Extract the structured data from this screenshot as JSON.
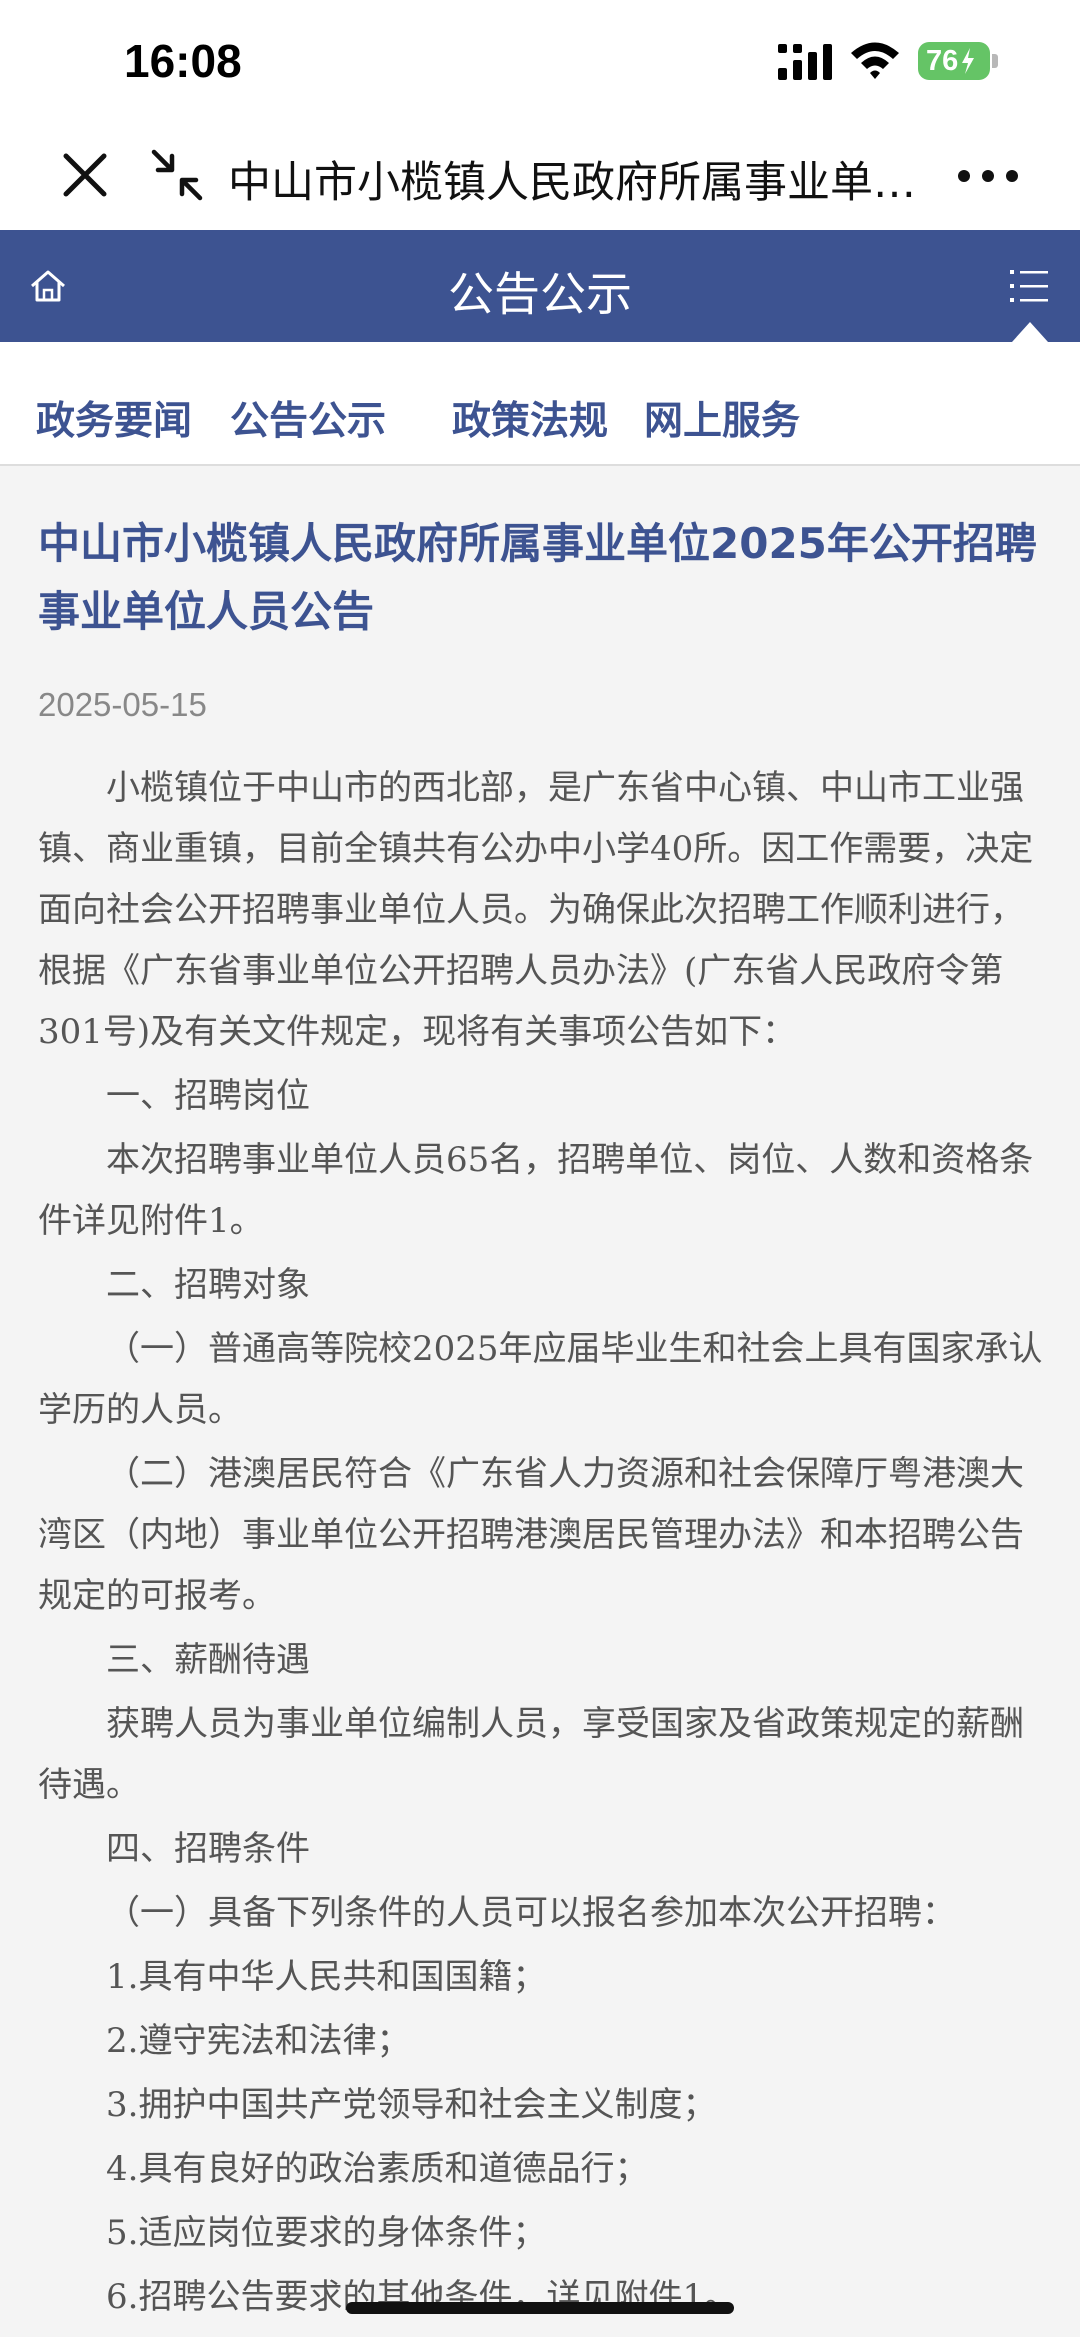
{
  "status_bar": {
    "time": "16:08",
    "battery": "76"
  },
  "nav_bar": {
    "title": "中山市小榄镇人民政府所属事业单…"
  },
  "header": {
    "title": "公告公示"
  },
  "tabs": [
    {
      "label": "政务要闻"
    },
    {
      "label": "公告公示"
    },
    {
      "label": "政策法规"
    },
    {
      "label": "网上服务"
    }
  ],
  "article": {
    "title": "中山市小榄镇人民政府所属事业单位2025年公开招聘事业单位人员公告",
    "date": "2025-05-15",
    "paragraphs": [
      "小榄镇位于中山市的西北部，是广东省中心镇、中山市工业强镇、商业重镇，目前全镇共有公办中小学40所。因工作需要，决定面向社会公开招聘事业单位人员。为确保此次招聘工作顺利进行，根据《广东省事业单位公开招聘人员办法》(广东省人民政府令第301号)及有关文件规定，现将有关事项公告如下：",
      "一、招聘岗位",
      "本次招聘事业单位人员65名，招聘单位、岗位、人数和资格条件详见附件1。",
      "二、招聘对象",
      "（一）普通高等院校2025年应届毕业生和社会上具有国家承认学历的人员。",
      "（二）港澳居民符合《广东省人力资源和社会保障厅粤港澳大湾区（内地）事业单位公开招聘港澳居民管理办法》和本招聘公告规定的可报考。",
      "三、薪酬待遇",
      "获聘人员为事业单位编制人员，享受国家及省政策规定的薪酬待遇。",
      "四、招聘条件",
      "（一）具备下列条件的人员可以报名参加本次公开招聘：",
      "1.具有中华人民共和国国籍；",
      "2.遵守宪法和法律；",
      "3.拥护中国共产党领导和社会主义制度；",
      "4.具有良好的政治素质和道德品行；",
      "5.适应岗位要求的身体条件；",
      "6.招聘公告要求的其他条件，详见附件1。"
    ]
  }
}
